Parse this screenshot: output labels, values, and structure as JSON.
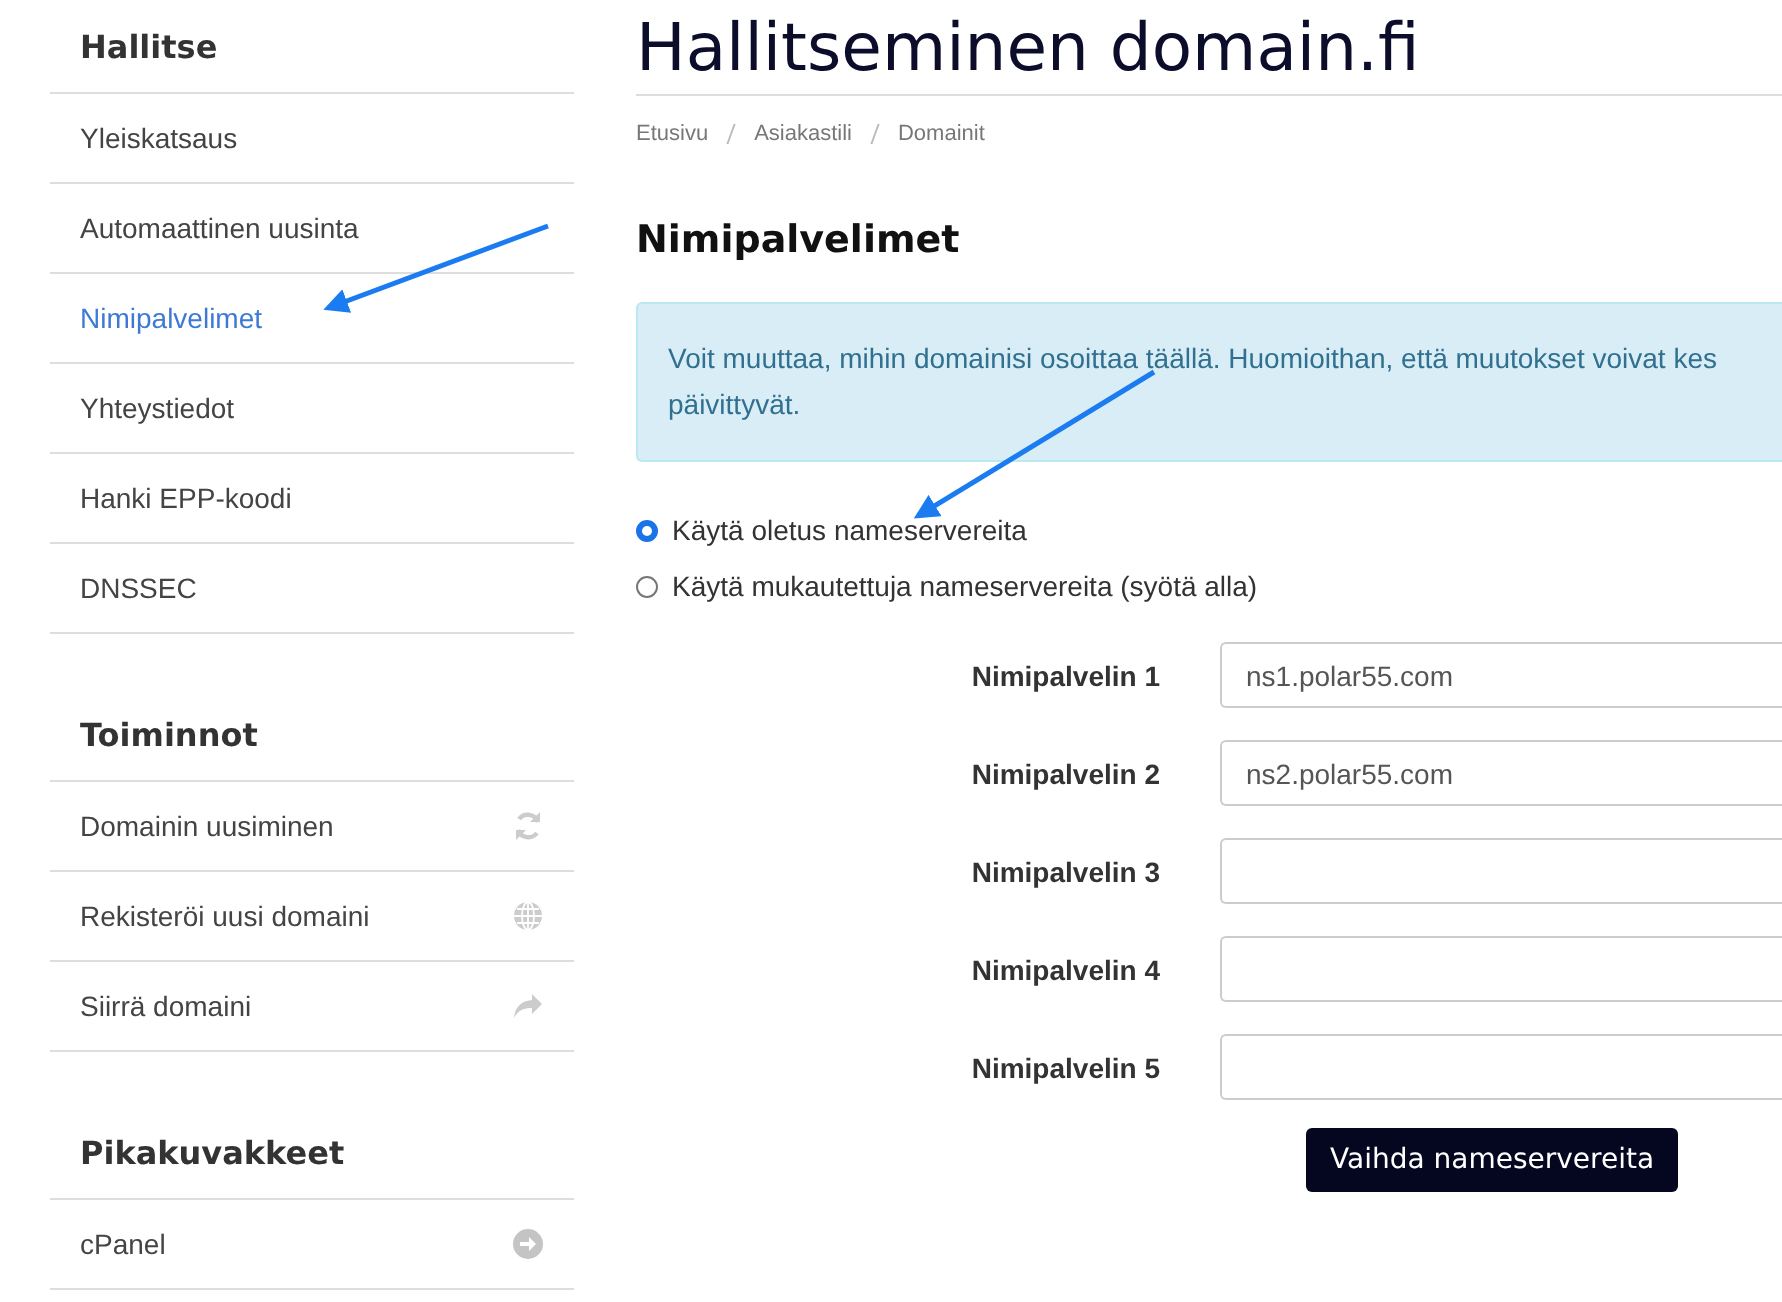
{
  "sidebar": {
    "sections": [
      {
        "title": "Hallitse",
        "items": [
          {
            "label": "Yleiskatsaus",
            "selected": false
          },
          {
            "label": "Automaattinen uusinta",
            "selected": false
          },
          {
            "label": "Nimipalvelimet",
            "selected": true
          },
          {
            "label": "Yhteystiedot",
            "selected": false
          },
          {
            "label": "Hanki EPP-koodi",
            "selected": false
          },
          {
            "label": "DNSSEC",
            "selected": false
          }
        ]
      },
      {
        "title": "Toiminnot",
        "items": [
          {
            "label": "Domainin uusiminen",
            "selected": false
          },
          {
            "label": "Rekisteröi uusi domaini",
            "selected": false
          },
          {
            "label": "Siirrä domaini",
            "selected": false
          }
        ]
      },
      {
        "title": "Pikakuvakkeet",
        "items": [
          {
            "label": "cPanel",
            "selected": false
          }
        ]
      }
    ]
  },
  "page": {
    "title": "Hallitseminen domain.fi",
    "breadcrumb": [
      "Etusivu",
      "Asiakastili",
      "Domainit"
    ],
    "heading": "Nimipalvelimet",
    "alert_lines": [
      "Voit muuttaa, mihin domainisi osoittaa täällä. Huomioithan, että muutokset voivat kes",
      "päivittyvät."
    ],
    "options": [
      {
        "label": "Käytä oletus nameservereita",
        "selected": true
      },
      {
        "label": "Käytä mukautettuja nameservereita (syötä alla)",
        "selected": false
      }
    ],
    "fields": [
      {
        "label": "Nimipalvelin 1",
        "value": "ns1.polar55.com"
      },
      {
        "label": "Nimipalvelin 2",
        "value": "ns2.polar55.com"
      },
      {
        "label": "Nimipalvelin 3"
      },
      {
        "label": "Nimipalvelin 4"
      },
      {
        "label": "Nimipalvelin 5"
      }
    ],
    "submit": "Vaihda nameservereita"
  }
}
